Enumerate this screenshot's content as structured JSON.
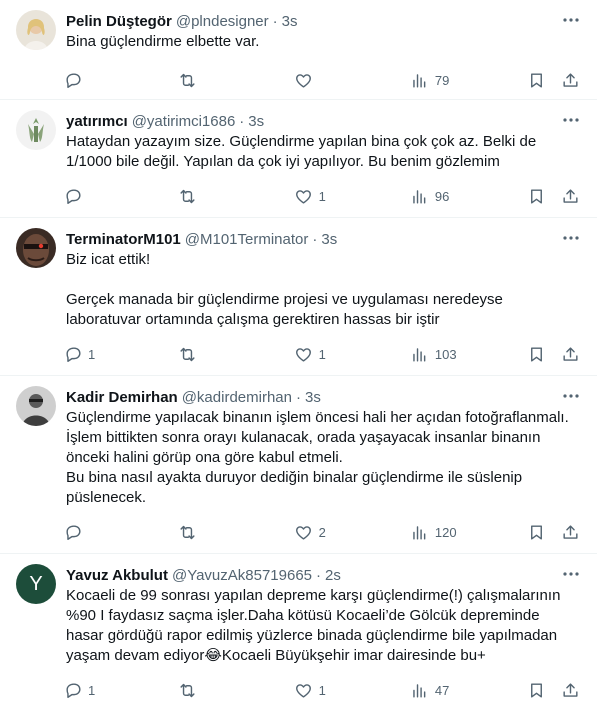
{
  "tweets": [
    {
      "name": "Pelin Düştegör",
      "handle": "@plndesigner",
      "time": "3s",
      "text": "Bina güçlendirme elbette var.",
      "replies": "",
      "retweets": "",
      "likes": "",
      "views": "79"
    },
    {
      "name": "yatırımcı",
      "handle": "@yatirimci1686",
      "time": "3s",
      "text": "Hataydan yazayım size. Güçlendirme yapılan bina çok çok az. Belki de 1/1000 bile değil. Yapılan da çok iyi yapılıyor. Bu benim gözlemim",
      "replies": "",
      "retweets": "",
      "likes": "1",
      "views": "96"
    },
    {
      "name": "TerminatorM101",
      "handle": "@M101Terminator",
      "time": "3s",
      "text": "Biz icat ettik!\n\nGerçek manada bir güçlendirme projesi ve uygulaması neredeyse laboratuvar ortamında çalışma gerektiren hassas bir iştir",
      "replies": "1",
      "retweets": "",
      "likes": "1",
      "views": "103"
    },
    {
      "name": "Kadir Demirhan",
      "handle": "@kadirdemirhan",
      "time": "3s",
      "text": "Güçlendirme yapılacak binanın işlem öncesi hali her açıdan fotoğraflanmalı.\nİşlem bittikten sonra orayı kulanacak, orada yaşayacak insanlar binanın önceki halini görüp ona göre kabul etmeli.\nBu bina nasıl ayakta duruyor dediğin binalar güçlendirme ile süslenip püslenecek.",
      "replies": "",
      "retweets": "",
      "likes": "2",
      "views": "120"
    },
    {
      "name": "Yavuz Akbulut",
      "handle": "@YavuzAk85719665",
      "time": "2s",
      "avatar_letter": "Y",
      "text": "Kocaeli de 99 sonrası yapılan depreme karşı güçlendirme(!) çalışmalarının %90 I faydasız saçma işler.Daha kötüsü Kocaeli’de Gölcük depreminde hasar gördüğü rapor edilmiş yüzlerce binada güçlendirme bile yapılmadan yaşam devam ediyor😂Kocaeli Büyükşehir imar dairesinde bu+",
      "replies": "1",
      "retweets": "",
      "likes": "1",
      "views": "47"
    }
  ],
  "colors": {
    "text": "#0f1419",
    "secondary": "#536471",
    "border": "#eff3f4"
  }
}
